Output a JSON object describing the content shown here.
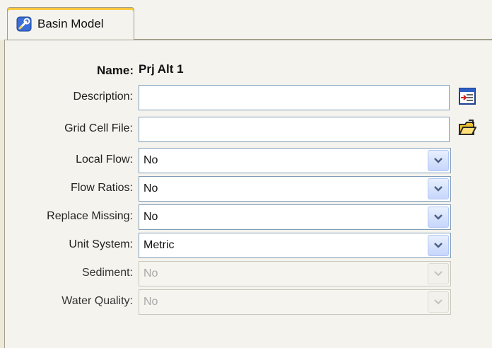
{
  "tab": {
    "label": "Basin Model",
    "icon": "basin-model-icon"
  },
  "name": {
    "label": "Name:",
    "value": "Prj Alt 1"
  },
  "description": {
    "label": "Description:",
    "value": "",
    "button_icon": "edit-description-icon"
  },
  "grid_cell_file": {
    "label": "Grid Cell File:",
    "value": "",
    "button_icon": "open-folder-icon"
  },
  "local_flow": {
    "label": "Local Flow:",
    "value": "No"
  },
  "flow_ratios": {
    "label": "Flow Ratios:",
    "value": "No"
  },
  "replace_missing": {
    "label": "Replace Missing:",
    "value": "No"
  },
  "unit_system": {
    "label": "Unit System:",
    "value": "Metric"
  },
  "sediment": {
    "label": "Sediment:",
    "value": "No",
    "disabled": true
  },
  "water_quality": {
    "label": "Water Quality:",
    "value": "No",
    "disabled": true
  },
  "colors": {
    "field_border": "#7f9db9",
    "dropdown_button": "#c6d6fb",
    "panel_bg": "#f4f3ee"
  }
}
